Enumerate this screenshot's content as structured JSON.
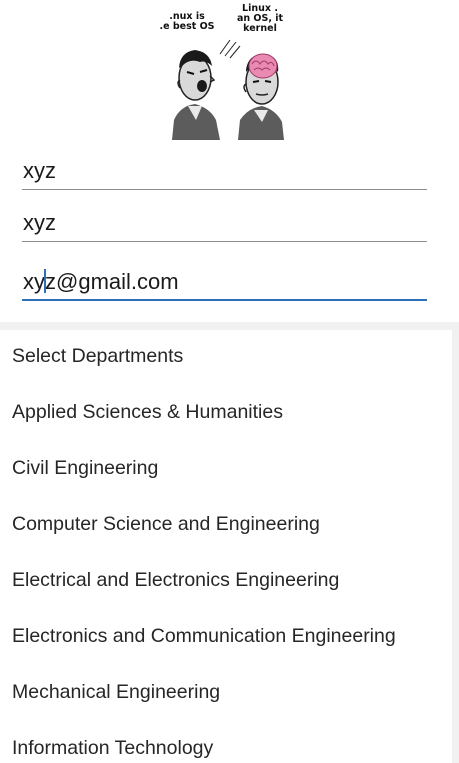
{
  "header_image": {
    "left_bubble": ".nux is\n.e best OS",
    "right_bubble": "Linux .\nan OS, it\nkernel"
  },
  "form": {
    "name_value": "xyz",
    "second_value": "xyz",
    "email_prefix": "xy",
    "email_suffix": "z@gmail.com"
  },
  "departments": {
    "header": "Select Departments",
    "items": [
      "Applied Sciences & Humanities",
      "Civil Engineering",
      "Computer Science and Engineering",
      "Electrical and Electronics Engineering",
      "Electronics and Communication Engineering",
      "Mechanical Engineering",
      "Information Technology"
    ]
  },
  "colors": {
    "accent": "#2f6fb8",
    "underline": "#8c8c8c",
    "background": "#f1f1f1"
  },
  "icons": [
    "argument-cartoon-icon"
  ]
}
